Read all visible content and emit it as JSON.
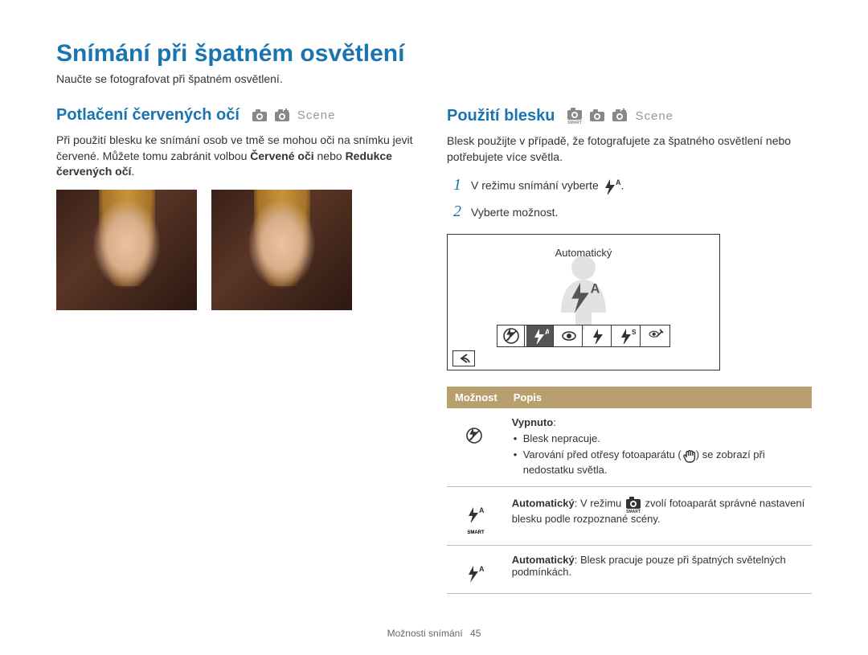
{
  "page": {
    "title": "Snímání při špatném osvětlení",
    "intro": "Naučte se fotografovat při špatném osvětlení."
  },
  "left": {
    "title": "Potlačení červených očí",
    "modes_scene": "Scene",
    "para_pre": "Při použití blesku ke snímání osob ve tmě se mohou oči na snímku jevit červené. Můžete tomu zabránit volbou ",
    "opt1_bold": "Červené oči",
    "mid": " nebo ",
    "opt2_bold": "Redukce červených očí",
    "end": "."
  },
  "right": {
    "title": "Použití blesku",
    "modes_scene": "Scene",
    "para": "Blesk použijte v případě, že fotografujete za špatného osvětlení nebo potřebujete více světla.",
    "step1": "V režimu snímání vyberte ",
    "step1_end": ".",
    "step2": "Vyberte možnost.",
    "lcd_label": "Automatický",
    "table": {
      "h1": "Možnost",
      "h2": "Popis",
      "row1": {
        "title": "Vypnuto",
        "colon": ":",
        "b1": "Blesk nepracuje.",
        "b2_pre": "Varování před otřesy fotoaparátu (",
        "b2_post": ") se zobrazí při nedostatku světla."
      },
      "row2": {
        "title": "Automatický",
        "rest": ": V režimu ",
        "rest2": " zvolí fotoaparát správné nastavení blesku podle rozpoznané scény."
      },
      "row3": {
        "title": "Automatický",
        "rest": ": Blesk pracuje pouze při špatných světelných podmínkách."
      }
    }
  },
  "footer": {
    "section": "Možnosti snímání",
    "page": "45"
  }
}
